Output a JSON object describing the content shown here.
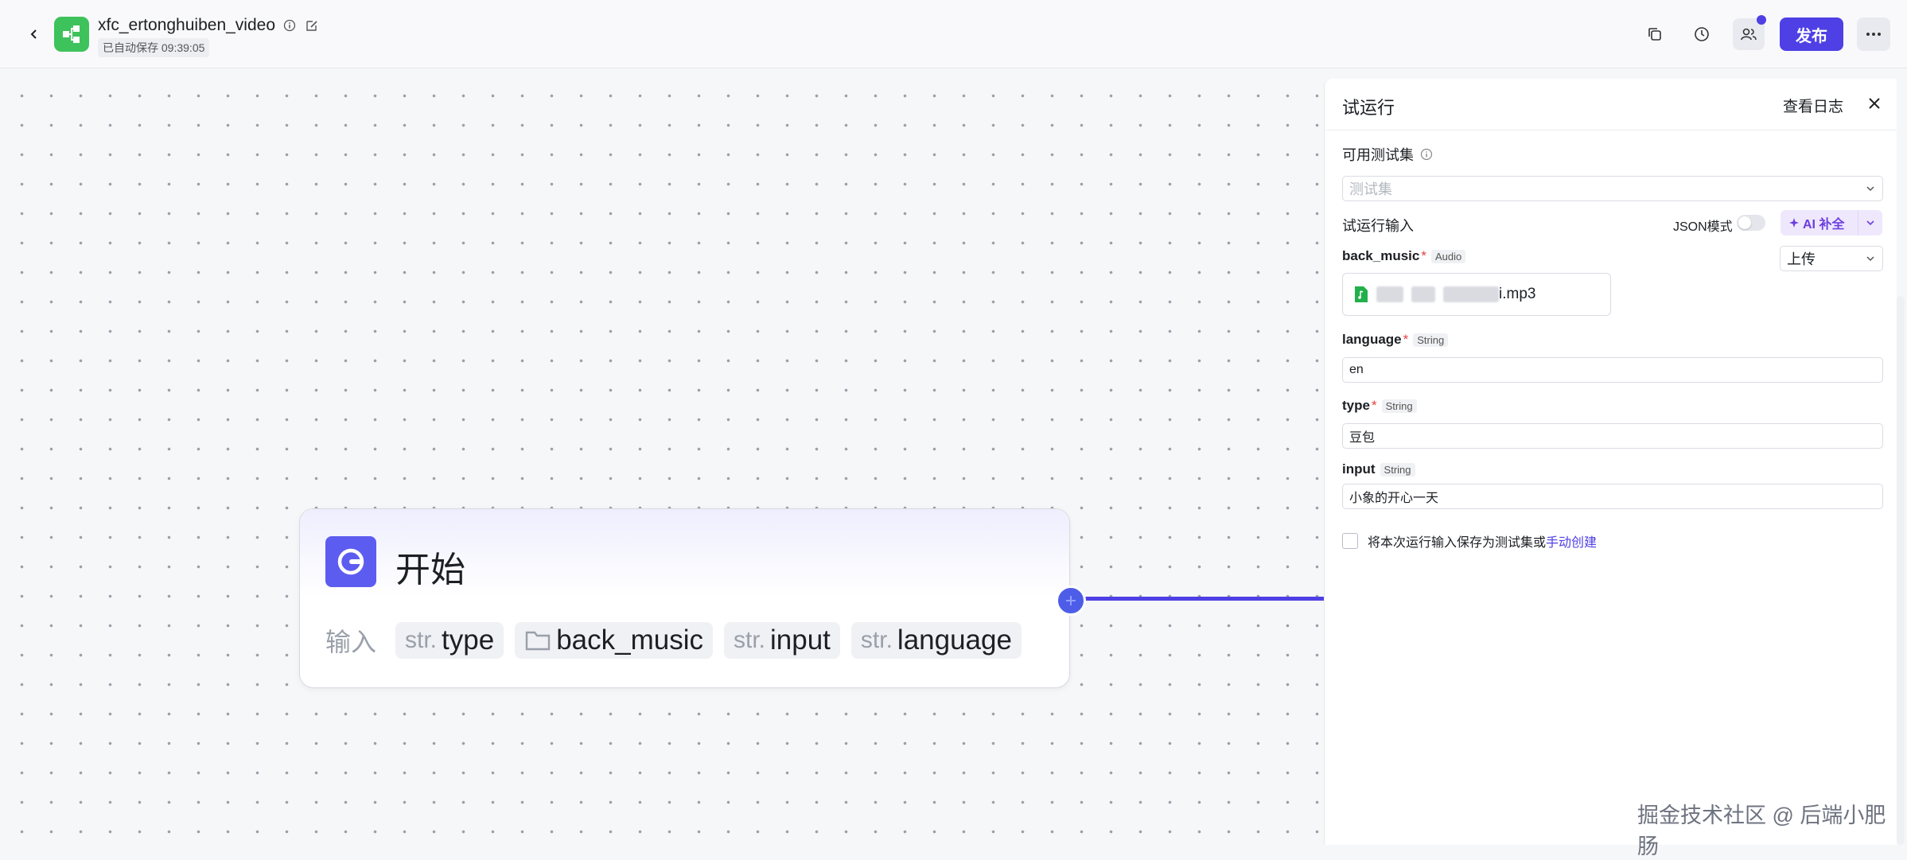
{
  "header": {
    "title": "xfc_ertonghuiben_video",
    "autosave": "已自动保存 09:39:05",
    "publish_label": "发布"
  },
  "node": {
    "title": "开始",
    "inputs_label": "输入",
    "inputs": [
      {
        "type": "str.",
        "name": "type"
      },
      {
        "type": "folder-icon",
        "name": "back_music"
      },
      {
        "type": "str.",
        "name": "input"
      },
      {
        "type": "str.",
        "name": "language"
      }
    ]
  },
  "panel": {
    "title": "试运行",
    "view_log": "查看日志",
    "test_set_label": "可用测试集",
    "test_set_placeholder": "测试集",
    "run_input_label": "试运行输入",
    "json_mode_label": "JSON模式",
    "ai_fill_label": "AI 补全",
    "fields": {
      "back_music": {
        "label": "back_music",
        "type": "Audio",
        "upload_mode": "上传",
        "file_suffix": "i.mp3"
      },
      "language": {
        "label": "language",
        "type": "String",
        "value": "en"
      },
      "type": {
        "label": "type",
        "type": "String",
        "value": "豆包"
      },
      "input": {
        "label": "input",
        "type": "String",
        "value": "小象的开心一天"
      }
    },
    "required_mark": "*",
    "save_text": "将本次运行输入保存为测试集或",
    "save_link": "手动创建"
  },
  "watermark": "掘金技术社区 @ 后端小肥肠",
  "colors": {
    "accent": "#4e40e5",
    "app_icon": "#3ec25b",
    "node_icon": "#5d5cf0"
  }
}
